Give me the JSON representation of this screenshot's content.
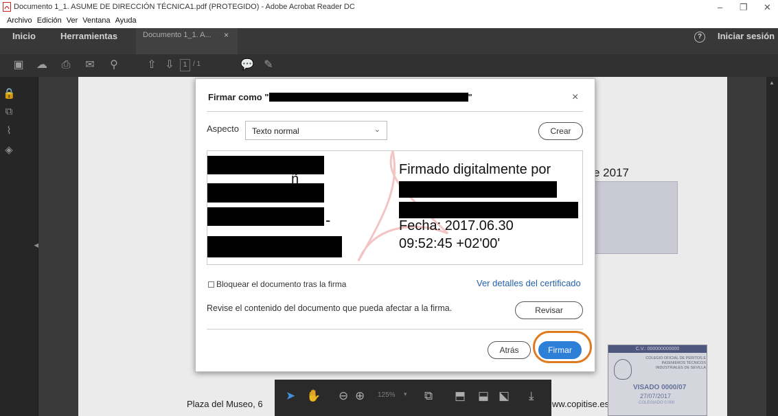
{
  "window": {
    "title": "Documento 1_1. ASUME DE DIRECCIÓN TÉCNICA1.pdf (PROTEGIDO) - Adobe Acrobat Reader DC",
    "minimize": "–",
    "restore": "❐",
    "close": "✕"
  },
  "menu": [
    "Archivo",
    "Edición",
    "Ver",
    "Ventana",
    "Ayuda"
  ],
  "nav": {
    "inicio": "Inicio",
    "herramientas": "Herramientas",
    "doc_tab": "Documento 1_1. A...",
    "doc_tab_close": "×",
    "help": "?",
    "signin": "Iniciar sesión"
  },
  "toolbar": {
    "page_current": "1",
    "page_total": "/ 1"
  },
  "dialog": {
    "title_prefix": "Firmar como \"",
    "title_suffix": "\"",
    "close": "×",
    "aspect_label": "Aspecto",
    "aspect_value": "Texto normal",
    "create_button": "Crear",
    "preview_right": {
      "line1": "Firmado digitalmente por",
      "fecha": "Fecha: 2017.06.30",
      "hora": "09:52:45 +02'00'"
    },
    "preview_left_fragment_1": "ñ",
    "preview_left_fragment_2": "-",
    "lock_checkbox_label": "Bloquear el documento tras la firma",
    "cert_link": "Ver detalles del certificado",
    "review_text": "Revise el contenido del documento que pueda afectar a la firma.",
    "review_button": "Revisar",
    "back_button": "Atrás",
    "sign_button": "Firmar"
  },
  "background_doc": {
    "year_fragment": "e 2017",
    "address": "Plaza del Museo, 6",
    "website": "ww.copitise.es",
    "stamp_code": "C.V.: 000000000000",
    "stamp_org": "COLEGIO OFICIAL DE PERITOS E INGENIEROS TÉCNICOS INDUSTRIALES DE SEVILLA",
    "visado": "VISADO 0000/07",
    "visado_date": "27/07/2017",
    "colegiado": "COLEGIADO 0.000"
  },
  "floatbar": {
    "zoom": "125%"
  },
  "colors": {
    "accent": "#2d7fd8",
    "highlight_ring": "#e07a1f",
    "link": "#2461a8"
  }
}
